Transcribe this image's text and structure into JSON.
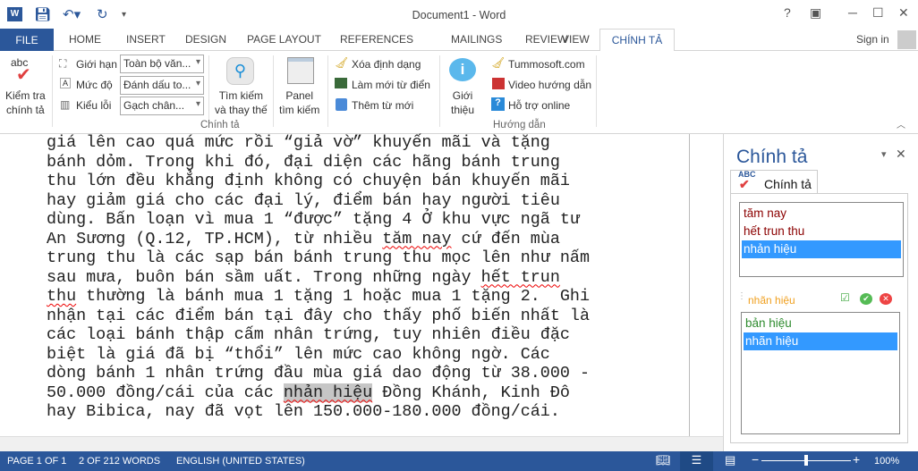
{
  "window": {
    "title": "Document1 - Word",
    "help": "?",
    "sign_in": "Sign in"
  },
  "tabs": {
    "file": "FILE",
    "items": [
      "HOME",
      "INSERT",
      "DESIGN",
      "PAGE LAYOUT",
      "REFERENCES",
      "MAILINGS",
      "REVIEW",
      "VIEW"
    ],
    "active": "CHÍNH TẢ"
  },
  "ribbon": {
    "check": [
      "Kiểm tra",
      "chính tả"
    ],
    "gioi_han": "Giới hạn",
    "muc_do": "Mức độ",
    "kieu_loi": "Kiểu lỗi",
    "sel_gioi_han": "Toàn bộ văn...",
    "sel_muc_do": "Đánh dấu to...",
    "sel_kieu_loi": "Gạch chân...",
    "search": [
      "Tìm kiếm",
      "và thay thế"
    ],
    "panel": [
      "Panel",
      "tìm kiếm"
    ],
    "xoa": "Xóa định dạng",
    "lam_moi": "Làm mới từ điển",
    "them": "Thêm từ mới",
    "group1": "Chính tả",
    "gioi_thieu": [
      "Giới",
      "thiệu"
    ],
    "tummo": "Tummosoft.com",
    "video": "Video hướng dẫn",
    "ho_tro": "Hỗ trợ online",
    "group2": "Hướng dẫn"
  },
  "document": {
    "lines": [
      [
        {
          "t": "giá lên cao quá mức rồi “giả vờ” khuyến mãi và tặng"
        }
      ],
      [
        {
          "t": "bánh dỏm. Trong khi đó, đại diện các hãng bánh trung"
        }
      ],
      [
        {
          "t": "thu lớn đều khẳng định không có chuyện bán khuyến mãi"
        }
      ],
      [
        {
          "t": "hay giảm giá cho các đại lý, điểm bán hay người tiêu"
        }
      ],
      [
        {
          "t": "dùng. Bấn loạn vì mua 1 “được” tặng 4 Ở khu vực ngã tư"
        }
      ],
      [
        {
          "t": "An Sương (Q.12, TP.HCM), từ nhiều "
        },
        {
          "t": "tăm nay",
          "err": true
        },
        {
          "t": " cứ đến mùa"
        }
      ],
      [
        {
          "t": "trung thu là các sạp bán bánh trung thu mọc lên như nấm"
        }
      ],
      [
        {
          "t": "sau mưa, buôn bán sầm uất. Trong những ngày "
        },
        {
          "t": "hết trun",
          "err": true
        }
      ],
      [
        {
          "t": "thu",
          "err": true
        },
        {
          "t": " thường là bánh mua 1 tặng 1 hoặc mua 1 tặng 2.  Ghi"
        }
      ],
      [
        {
          "t": "nhận tại các điểm bán tại đây cho thấy phố biến nhất là"
        }
      ],
      [
        {
          "t": "các loại bánh thập cấm nhân trứng, tuy nhiên điều đặc"
        }
      ],
      [
        {
          "t": "biệt là giá đã bị “thổi” lên mức cao không ngờ. Các"
        }
      ],
      [
        {
          "t": "dòng bánh 1 nhân trứng đầu mùa giá dao động từ 38.000 -"
        }
      ],
      [
        {
          "t": "50.000 đồng/cái của các "
        },
        {
          "t": "nhản hiệu",
          "err": true,
          "hl": true
        },
        {
          "t": " Đồng Khánh, Kinh Đô"
        }
      ],
      [
        {
          "t": "hay Bibica, nay đã vọt lên 150.000-180.000 đồng/cái."
        }
      ]
    ]
  },
  "pane": {
    "title": "Chính tả",
    "tab": "Chính tả",
    "abc": "ABC",
    "errors": [
      "tăm nay",
      "hết trun thu",
      "nhản hiệu"
    ],
    "selected_error": 2,
    "current_word": "nhãn hiệu",
    "suggestions": [
      "bản hiệu",
      "nhãn hiệu"
    ],
    "selected_suggestion": 1
  },
  "status": {
    "page": "PAGE 1 OF 1",
    "words": "2 OF 212 WORDS",
    "lang": "ENGLISH (UNITED STATES)",
    "zoom": "100%",
    "zoom_value": 100
  },
  "colors": {
    "accent": "#2b579a",
    "error_text": "#8b0000",
    "suggestion_text": "#2e8b2e",
    "current_word": "#f0a020",
    "selection": "#3399ff"
  }
}
